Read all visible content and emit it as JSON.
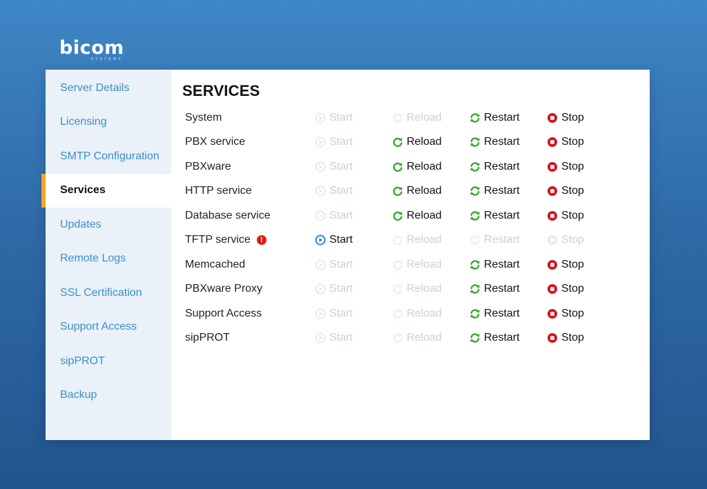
{
  "brand": {
    "name": "bicom",
    "tagline": "SYSTEMS"
  },
  "colors": {
    "accent": "#f5a623",
    "link": "#3a8fce",
    "start_blue": "#1f8ad8",
    "reload_green": "#3aa630",
    "restart_green": "#3aa630",
    "stop_red": "#d4141f"
  },
  "sidebar": {
    "items": [
      {
        "label": "Server Details",
        "active": false
      },
      {
        "label": "Licensing",
        "active": false
      },
      {
        "label": "SMTP Configuration",
        "active": false
      },
      {
        "label": "Services",
        "active": true
      },
      {
        "label": "Updates",
        "active": false
      },
      {
        "label": "Remote Logs",
        "active": false
      },
      {
        "label": "SSL Certification",
        "active": false
      },
      {
        "label": "Support Access",
        "active": false
      },
      {
        "label": "sipPROT",
        "active": false
      },
      {
        "label": "Backup",
        "active": false
      }
    ]
  },
  "main": {
    "title": "SERVICES",
    "action_labels": {
      "start": "Start",
      "reload": "Reload",
      "restart": "Restart",
      "stop": "Stop"
    },
    "services": [
      {
        "name": "System",
        "warning": false,
        "start": false,
        "reload": false,
        "restart": true,
        "stop": true
      },
      {
        "name": "PBX service",
        "warning": false,
        "start": false,
        "reload": true,
        "restart": true,
        "stop": true
      },
      {
        "name": "PBXware",
        "warning": false,
        "start": false,
        "reload": true,
        "restart": true,
        "stop": true
      },
      {
        "name": "HTTP service",
        "warning": false,
        "start": false,
        "reload": true,
        "restart": true,
        "stop": true
      },
      {
        "name": "Database service",
        "warning": false,
        "start": false,
        "reload": true,
        "restart": true,
        "stop": true
      },
      {
        "name": "TFTP service",
        "warning": true,
        "start": true,
        "reload": false,
        "restart": false,
        "stop": false
      },
      {
        "name": "Memcached",
        "warning": false,
        "start": false,
        "reload": false,
        "restart": true,
        "stop": true
      },
      {
        "name": "PBXware Proxy",
        "warning": false,
        "start": false,
        "reload": false,
        "restart": true,
        "stop": true
      },
      {
        "name": "Support Access",
        "warning": false,
        "start": false,
        "reload": false,
        "restart": true,
        "stop": true
      },
      {
        "name": "sipPROT",
        "warning": false,
        "start": false,
        "reload": false,
        "restart": true,
        "stop": true
      }
    ]
  }
}
